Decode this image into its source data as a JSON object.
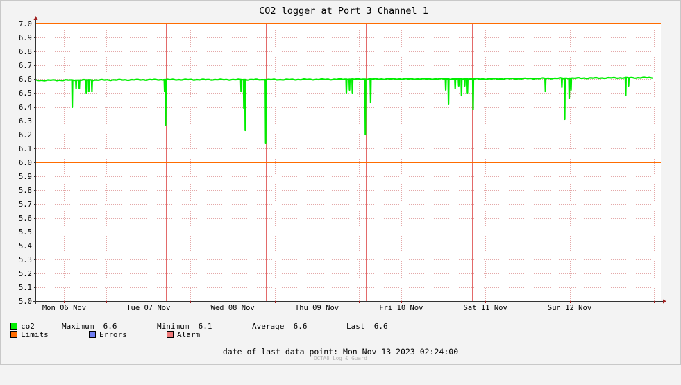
{
  "colors": {
    "background": "#f3f3f3",
    "plot_background": "#ffffff",
    "grid": "#e4a8a8",
    "day_marker": "#e36a6a",
    "series": "#00ee00",
    "limits": "#ff6c00",
    "errors": "#6f7df2",
    "alarm": "#f07a7a"
  },
  "chart_data": {
    "type": "line",
    "title": "CO2 logger at Port 3 Channel 1",
    "xlabel": "",
    "ylabel": "",
    "ylim": [
      5.0,
      7.0
    ],
    "y_ticks": [
      "7.0",
      "6.9",
      "6.8",
      "6.7",
      "6.6",
      "6.5",
      "6.4",
      "6.3",
      "6.2",
      "6.1",
      "6.0",
      "5.9",
      "5.8",
      "5.7",
      "5.6",
      "5.5",
      "5.4",
      "5.3",
      "5.2",
      "5.1",
      "5.0"
    ],
    "x_days": [
      "Mon 06 Nov",
      "Tue 07 Nov",
      "Wed 08 Nov",
      "Thu 09 Nov",
      "Fri 10 Nov",
      "Sat 11 Nov",
      "Sun 12 Nov"
    ],
    "x_range_hours": [
      -8,
      170
    ],
    "grid": true,
    "limits": {
      "upper": 7.0,
      "lower": 6.0
    },
    "event_markers_hours": [
      29.0,
      57.4,
      86.0,
      116.3
    ],
    "series": [
      {
        "name": "co2",
        "baseline": [
          [
            -8,
            6.59
          ],
          [
            30,
            6.595
          ],
          [
            60,
            6.595
          ],
          [
            95,
            6.6
          ],
          [
            120,
            6.6
          ],
          [
            140,
            6.605
          ],
          [
            168,
            6.61
          ]
        ],
        "dips": [
          [
            2.3,
            6.4
          ],
          [
            3.4,
            6.53
          ],
          [
            4.3,
            6.53
          ],
          [
            6.3,
            6.5
          ],
          [
            7.0,
            6.51
          ],
          [
            7.9,
            6.51
          ],
          [
            28.6,
            6.51
          ],
          [
            28.9,
            6.27
          ],
          [
            50.4,
            6.51
          ],
          [
            51.2,
            6.39
          ],
          [
            51.6,
            6.23
          ],
          [
            57.4,
            6.14
          ],
          [
            80.4,
            6.5
          ],
          [
            81.3,
            6.52
          ],
          [
            82.1,
            6.5
          ],
          [
            85.8,
            6.2
          ],
          [
            87.3,
            6.43
          ],
          [
            108.7,
            6.52
          ],
          [
            109.5,
            6.42
          ],
          [
            111.4,
            6.53
          ],
          [
            112.4,
            6.55
          ],
          [
            113.2,
            6.48
          ],
          [
            114.1,
            6.55
          ],
          [
            114.9,
            6.5
          ],
          [
            116.5,
            6.38
          ],
          [
            137.1,
            6.51
          ],
          [
            141.8,
            6.54
          ],
          [
            142.6,
            6.31
          ],
          [
            143.9,
            6.46
          ],
          [
            144.4,
            6.52
          ],
          [
            160.0,
            6.48
          ],
          [
            160.8,
            6.55
          ]
        ]
      }
    ]
  },
  "legend": {
    "row1": [
      {
        "text": "co2",
        "swatch": "series"
      },
      {
        "text": "Maximum  6.6"
      },
      {
        "text": "Minimum  6.1"
      },
      {
        "text": "Average  6.6"
      },
      {
        "text": "Last  6.6"
      }
    ],
    "row2": [
      {
        "text": "Limits",
        "swatch": "limits"
      },
      {
        "text": "Errors",
        "swatch": "errors"
      },
      {
        "text": "Alarm",
        "swatch": "alarm"
      }
    ]
  },
  "footer": {
    "last_point": "date of last data point:  Mon Nov 13 2023 02:24:00",
    "watermark": "OCTA8 Log & Guard"
  }
}
